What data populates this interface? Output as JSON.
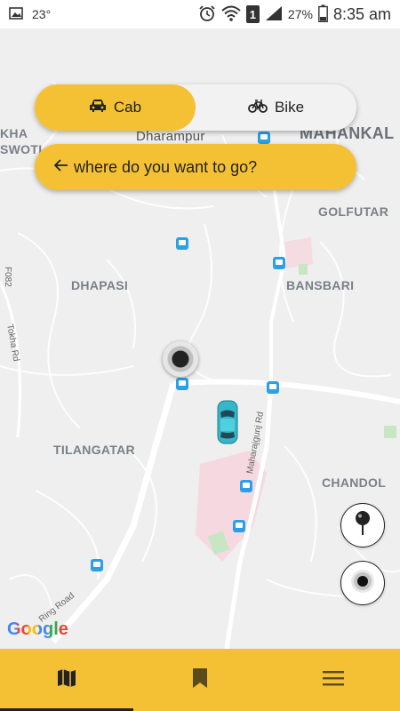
{
  "status_bar": {
    "notification_icon": "image-icon",
    "temperature": "23°",
    "icons": [
      "alarm-icon",
      "wifi-icon",
      "sim-icon",
      "signal-icon",
      "battery-icon"
    ],
    "sim_label": "1",
    "battery_percent": "27%",
    "time": "8:35 am"
  },
  "mode_toggle": {
    "options": [
      {
        "label": "Cab",
        "icon": "car-icon",
        "active": true
      },
      {
        "label": "Bike",
        "icon": "bike-icon",
        "active": false
      }
    ]
  },
  "search": {
    "icon": "arrow-left-icon",
    "placeholder": "where do you want to go?"
  },
  "map": {
    "labels": {
      "kha": "KHA",
      "swoti": "SWOTI",
      "dharampur": "Dharampur",
      "mahankal": "MAHANKAL",
      "golfutar": "GOLFUTAR",
      "dhapasi": "DHAPASI",
      "bansbari": "BANSBARI",
      "tilangatar": "TILANGATAR",
      "chandol": "CHANDOL"
    },
    "roads": {
      "f082": "F082",
      "tokha_rd": "Tokha Rd",
      "maharajgunj_rd": "Maharajgunj Rd",
      "ring_road": "Ring Road"
    },
    "attribution": "Google",
    "colors": {
      "background": "#efefef",
      "road": "#ffffff",
      "bus_stop": "#2aa0e8",
      "car": "#35b6c9"
    }
  },
  "fabs": [
    {
      "name": "pin-drop-button",
      "icon": "map-pin-icon"
    },
    {
      "name": "my-location-button",
      "icon": "target-icon"
    }
  ],
  "bottom_nav": {
    "items": [
      {
        "icon": "map-icon",
        "active": true
      },
      {
        "icon": "bookmark-icon",
        "active": false
      },
      {
        "icon": "menu-icon",
        "active": false
      }
    ]
  },
  "accent_color": "#f5c134"
}
